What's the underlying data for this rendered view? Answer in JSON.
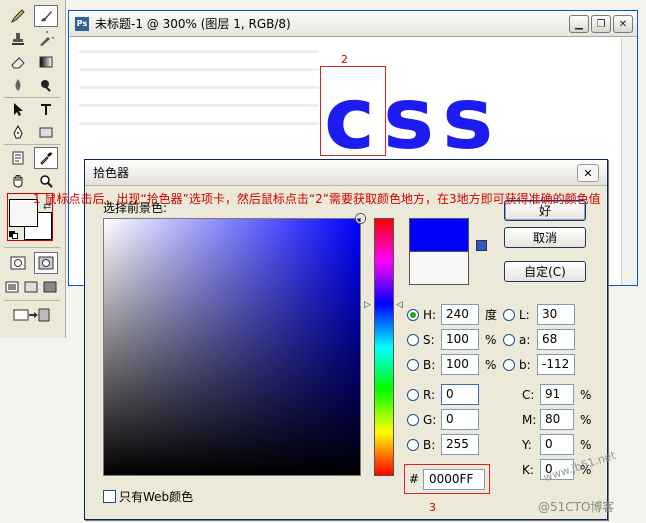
{
  "document": {
    "title": "未标题-1 @ 300% (图层 1, RGB/8)",
    "canvas_text": "css",
    "marker2_label": "2",
    "window_buttons": {
      "minimize": "▁",
      "restore": "❐",
      "close": "✕"
    }
  },
  "annotation": {
    "arrow": "↓",
    "text": "1 鼠标点击后，出现“拾色器”选项卡，然后鼠标点击“2”需要获取颜色地方，在3地方即可获得准确的颜色值"
  },
  "toolbox": {
    "icons": [
      "pencil-icon",
      "brush-icon",
      "stamp-icon",
      "history-brush-icon",
      "eraser-icon",
      "gradient-icon",
      "blur-icon",
      "dodge-icon",
      "path-select-icon",
      "type-icon",
      "pen-icon",
      "rectangle-icon",
      "notes-icon",
      "eyedropper-icon",
      "hand-icon",
      "zoom-icon"
    ],
    "foreground_color": "#f7f7f7",
    "background_color": "#ffffff"
  },
  "picker": {
    "title": "拾色器",
    "close": "✕",
    "heading": "选择前景色:",
    "buttons": {
      "ok": "好",
      "cancel": "取消",
      "custom": "自定(C)"
    },
    "hsb": [
      {
        "label": "H:",
        "value": "240",
        "unit": "度",
        "selected": true
      },
      {
        "label": "S:",
        "value": "100",
        "unit": "%",
        "selected": false
      },
      {
        "label": "B:",
        "value": "100",
        "unit": "%",
        "selected": false
      }
    ],
    "lab": [
      {
        "label": "L:",
        "value": "30"
      },
      {
        "label": "a:",
        "value": "68"
      },
      {
        "label": "b:",
        "value": "-112"
      }
    ],
    "rgb": [
      {
        "label": "R:",
        "value": "0"
      },
      {
        "label": "G:",
        "value": "0"
      },
      {
        "label": "B:",
        "value": "255"
      }
    ],
    "cmyk": [
      {
        "label": "C:",
        "value": "91",
        "unit": "%"
      },
      {
        "label": "M:",
        "value": "80",
        "unit": "%"
      },
      {
        "label": "Y:",
        "value": "0",
        "unit": "%"
      },
      {
        "label": "K:",
        "value": "0",
        "unit": "%"
      }
    ],
    "hex_hash": "#",
    "hex": "0000FF",
    "marker3_label": "3",
    "web_only": "只有Web颜色",
    "new_color": "#0000ff",
    "old_color": "#f7f7f7"
  },
  "watermark": {
    "line1": "www.jb51.net",
    "line2": "@51CTO博客"
  }
}
